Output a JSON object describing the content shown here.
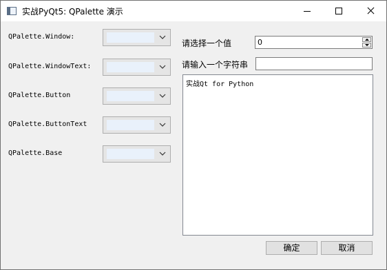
{
  "window": {
    "title": "实战PyQt5: QPalette 演示",
    "app_icon": "window-app-icon",
    "controls": [
      "minimize-icon",
      "maximize-icon",
      "close-icon"
    ]
  },
  "palette_roles": [
    {
      "label": "QPalette.Window:",
      "swatch_color": "#e9f1fb"
    },
    {
      "label": "QPalette.WindowText:",
      "swatch_color": "#e9f1fb"
    },
    {
      "label": "QPalette.Button",
      "swatch_color": "#e9f1fb"
    },
    {
      "label": "QPalette.ButtonText",
      "swatch_color": "#e9f1fb"
    },
    {
      "label": "QPalette.Base",
      "swatch_color": "#e9f1fb"
    }
  ],
  "form": {
    "spin_label": "请选择一个值",
    "spin_value": "0",
    "line_label": "请输入一个字符串",
    "line_value": "",
    "text_content": "实战Qt for Python"
  },
  "buttons": {
    "ok": "确定",
    "cancel": "取消"
  },
  "colors": {
    "window_bg": "#f0f0f0",
    "titlebar_bg": "#ffffff",
    "button_bg": "#e1e1e1",
    "input_border": "#7a7a7a"
  }
}
